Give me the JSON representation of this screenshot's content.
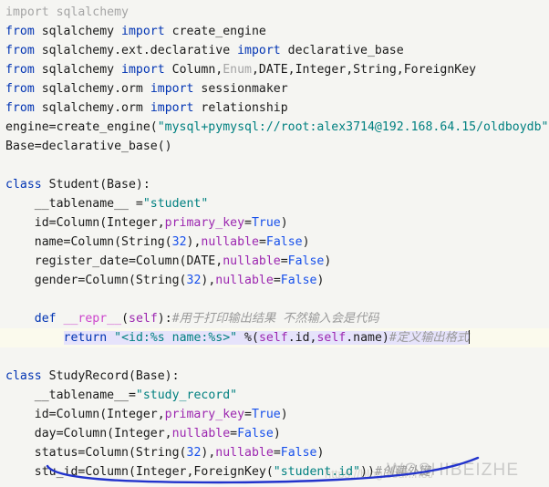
{
  "editor": {
    "language": "python",
    "background_color": "#f5f5f2",
    "current_line_color": "#fbfaed",
    "selection_color": "#e6e3fb",
    "annotation_color": "#2233cc"
  },
  "code_lines": [
    {
      "id": 1,
      "text": "import sqlalchemy",
      "tokens": [
        {
          "t": "import sqlalchemy",
          "c": "dim"
        }
      ]
    },
    {
      "id": 2,
      "text": "from sqlalchemy import create_engine",
      "tokens": [
        {
          "t": "from",
          "c": "kw"
        },
        {
          "t": " sqlalchemy ",
          "c": "plain"
        },
        {
          "t": "import",
          "c": "kw"
        },
        {
          "t": " create_engine",
          "c": "plain"
        }
      ]
    },
    {
      "id": 3,
      "text": "from sqlalchemy.ext.declarative import declarative_base",
      "tokens": [
        {
          "t": "from",
          "c": "kw"
        },
        {
          "t": " sqlalchemy.ext.declarative ",
          "c": "plain"
        },
        {
          "t": "import",
          "c": "kw"
        },
        {
          "t": " declarative_base",
          "c": "plain"
        }
      ]
    },
    {
      "id": 4,
      "text": "from sqlalchemy import Column,Enum,DATE,Integer,String,ForeignKey",
      "tokens": [
        {
          "t": "from",
          "c": "kw"
        },
        {
          "t": " sqlalchemy ",
          "c": "plain"
        },
        {
          "t": "import",
          "c": "kw"
        },
        {
          "t": " Column,",
          "c": "plain"
        },
        {
          "t": "Enum",
          "c": "dim"
        },
        {
          "t": ",DATE,Integer,String,ForeignKey",
          "c": "plain"
        }
      ]
    },
    {
      "id": 5,
      "text": "from sqlalchemy.orm import sessionmaker",
      "tokens": [
        {
          "t": "from",
          "c": "kw"
        },
        {
          "t": " sqlalchemy.orm ",
          "c": "plain"
        },
        {
          "t": "import",
          "c": "kw"
        },
        {
          "t": " sessionmaker",
          "c": "plain"
        }
      ]
    },
    {
      "id": 6,
      "text": "from sqlalchemy.orm import relationship",
      "tokens": [
        {
          "t": "from",
          "c": "kw"
        },
        {
          "t": " sqlalchemy.orm ",
          "c": "plain"
        },
        {
          "t": "import",
          "c": "kw"
        },
        {
          "t": " relationship",
          "c": "plain"
        }
      ]
    },
    {
      "id": 7,
      "text": "engine=create_engine(\"mysql+pymysql://root:alex3714@192.168.64.15/oldboydb\"",
      "tokens": [
        {
          "t": "engine=create_engine(",
          "c": "plain"
        },
        {
          "t": "\"mysql+pymysql://root:alex3714@192.168.64.15/oldboydb\"",
          "c": "str"
        }
      ]
    },
    {
      "id": 8,
      "text": "Base=declarative_base()",
      "tokens": [
        {
          "t": "Base=declarative_base()",
          "c": "plain"
        }
      ]
    },
    {
      "id": 9,
      "text": "",
      "tokens": []
    },
    {
      "id": 10,
      "text": "class Student(Base):",
      "tokens": [
        {
          "t": "class",
          "c": "kw"
        },
        {
          "t": " Student(Base):",
          "c": "plain"
        }
      ]
    },
    {
      "id": 11,
      "text": "    __tablename__ =\"student\"",
      "tokens": [
        {
          "t": "    __tablename__ =",
          "c": "plain"
        },
        {
          "t": "\"student\"",
          "c": "str"
        }
      ]
    },
    {
      "id": 12,
      "text": "    id=Column(Integer,primary_key=True)",
      "tokens": [
        {
          "t": "    id=Column(Integer,",
          "c": "plain"
        },
        {
          "t": "primary_key",
          "c": "kwarg"
        },
        {
          "t": "=",
          "c": "plain"
        },
        {
          "t": "True",
          "c": "const"
        },
        {
          "t": ")",
          "c": "plain"
        }
      ]
    },
    {
      "id": 13,
      "text": "    name=Column(String(32),nullable=False)",
      "tokens": [
        {
          "t": "    name=Column(String(",
          "c": "plain"
        },
        {
          "t": "32",
          "c": "num"
        },
        {
          "t": "),",
          "c": "plain"
        },
        {
          "t": "nullable",
          "c": "kwarg"
        },
        {
          "t": "=",
          "c": "plain"
        },
        {
          "t": "False",
          "c": "const"
        },
        {
          "t": ")",
          "c": "plain"
        }
      ]
    },
    {
      "id": 14,
      "text": "    register_date=Column(DATE,nullable=False)",
      "tokens": [
        {
          "t": "    register_date=Column(DATE,",
          "c": "plain"
        },
        {
          "t": "nullable",
          "c": "kwarg"
        },
        {
          "t": "=",
          "c": "plain"
        },
        {
          "t": "False",
          "c": "const"
        },
        {
          "t": ")",
          "c": "plain"
        }
      ]
    },
    {
      "id": 15,
      "text": "    gender=Column(String(32),nullable=False)",
      "tokens": [
        {
          "t": "    gender=Column(String(",
          "c": "plain"
        },
        {
          "t": "32",
          "c": "num"
        },
        {
          "t": "),",
          "c": "plain"
        },
        {
          "t": "nullable",
          "c": "kwarg"
        },
        {
          "t": "=",
          "c": "plain"
        },
        {
          "t": "False",
          "c": "const"
        },
        {
          "t": ")",
          "c": "plain"
        }
      ]
    },
    {
      "id": 16,
      "text": "",
      "tokens": []
    },
    {
      "id": 17,
      "text": "    def __repr__(self):#用于打印输出结果 不然输入会是代码",
      "tokens": [
        {
          "t": "    ",
          "c": "plain"
        },
        {
          "t": "def",
          "c": "kw"
        },
        {
          "t": " ",
          "c": "plain"
        },
        {
          "t": "__repr__",
          "c": "magic"
        },
        {
          "t": "(",
          "c": "plain"
        },
        {
          "t": "self",
          "c": "selfw"
        },
        {
          "t": "):",
          "c": "plain"
        },
        {
          "t": "#用于打印输出结果 不然输入会是代码",
          "c": "cmt"
        }
      ]
    },
    {
      "id": 18,
      "text": "        return \"<id:%s name:%s>\" %(self.id,self.name)#定义输出格式",
      "current_line": true,
      "selected": true,
      "caret_at_end": true,
      "tokens": [
        {
          "t": "        ",
          "c": "plain"
        },
        {
          "t": "return",
          "c": "kw",
          "sel": true
        },
        {
          "t": " ",
          "c": "plain",
          "sel": true
        },
        {
          "t": "\"<id:%s name:%s>\"",
          "c": "str",
          "sel": true
        },
        {
          "t": " %(",
          "c": "plain",
          "sel": true
        },
        {
          "t": "self",
          "c": "selfw",
          "sel": true
        },
        {
          "t": ".id,",
          "c": "plain",
          "sel": true
        },
        {
          "t": "self",
          "c": "selfw",
          "sel": true
        },
        {
          "t": ".name)",
          "c": "plain",
          "sel": true
        },
        {
          "t": "#定义输出格式",
          "c": "cmt",
          "sel": true
        }
      ]
    },
    {
      "id": 19,
      "text": "",
      "tokens": []
    },
    {
      "id": 20,
      "text": "class StudyRecord(Base):",
      "tokens": [
        {
          "t": "class",
          "c": "kw"
        },
        {
          "t": " StudyRecord(Base):",
          "c": "plain"
        }
      ]
    },
    {
      "id": 21,
      "text": "    __tablename__=\"study_record\"",
      "tokens": [
        {
          "t": "    __tablename__=",
          "c": "plain"
        },
        {
          "t": "\"study_record\"",
          "c": "str"
        }
      ]
    },
    {
      "id": 22,
      "text": "    id=Column(Integer,primary_key=True)",
      "tokens": [
        {
          "t": "    id=Column(Integer,",
          "c": "plain"
        },
        {
          "t": "primary_key",
          "c": "kwarg"
        },
        {
          "t": "=",
          "c": "plain"
        },
        {
          "t": "True",
          "c": "const"
        },
        {
          "t": ")",
          "c": "plain"
        }
      ]
    },
    {
      "id": 23,
      "text": "    day=Column(Integer,nullable=False)",
      "tokens": [
        {
          "t": "    day=Column(Integer,",
          "c": "plain"
        },
        {
          "t": "nullable",
          "c": "kwarg"
        },
        {
          "t": "=",
          "c": "plain"
        },
        {
          "t": "False",
          "c": "const"
        },
        {
          "t": ")",
          "c": "plain"
        }
      ]
    },
    {
      "id": 24,
      "text": "    status=Column(String(32),nullable=False)",
      "tokens": [
        {
          "t": "    status=Column(String(",
          "c": "plain"
        },
        {
          "t": "32",
          "c": "num"
        },
        {
          "t": "),",
          "c": "plain"
        },
        {
          "t": "nullable",
          "c": "kwarg"
        },
        {
          "t": "=",
          "c": "plain"
        },
        {
          "t": "False",
          "c": "const"
        },
        {
          "t": ")",
          "c": "plain"
        }
      ]
    },
    {
      "id": 25,
      "text": "    stu_id=Column(Integer,ForeignKey(\"student.id\"))#创建外键",
      "tokens": [
        {
          "t": "    stu_id=Column(Integer,ForeignKey(",
          "c": "plain"
        },
        {
          "t": "\"student.id\"",
          "c": "str"
        },
        {
          "t": "))",
          "c": "plain"
        },
        {
          "t": "#创建外键",
          "c": "cmt"
        }
      ]
    }
  ],
  "watermarks": {
    "main": "WOSHIBEIZHE",
    "url": "https://blog.csdn.net/"
  }
}
